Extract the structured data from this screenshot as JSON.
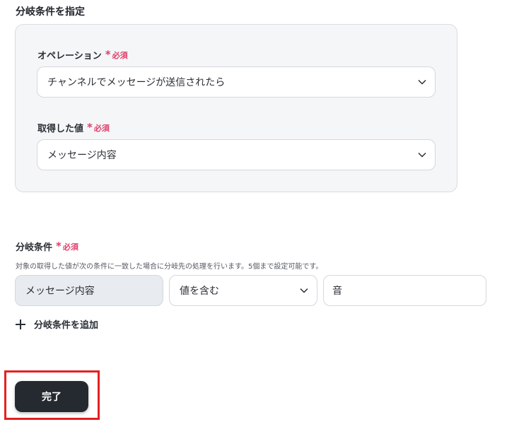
{
  "section_title": "分岐条件を指定",
  "required_label": "必須",
  "operation": {
    "label": "オペレーション",
    "value": "チャンネルでメッセージが送信されたら"
  },
  "acquired_value": {
    "label": "取得した値",
    "value": "メッセージ内容"
  },
  "branch_condition": {
    "label": "分岐条件",
    "help": "対象の取得した値が次の条件に一致した場合に分岐先の処理を行います。5個まで設定可能です。",
    "field": "メッセージ内容",
    "operator": "値を含む",
    "value": "音"
  },
  "add_condition_label": "分岐条件を追加",
  "done_label": "完了",
  "colors": {
    "accent_required": "#e03e6b",
    "highlight": "#e52020",
    "primary_button": "#252a31"
  }
}
